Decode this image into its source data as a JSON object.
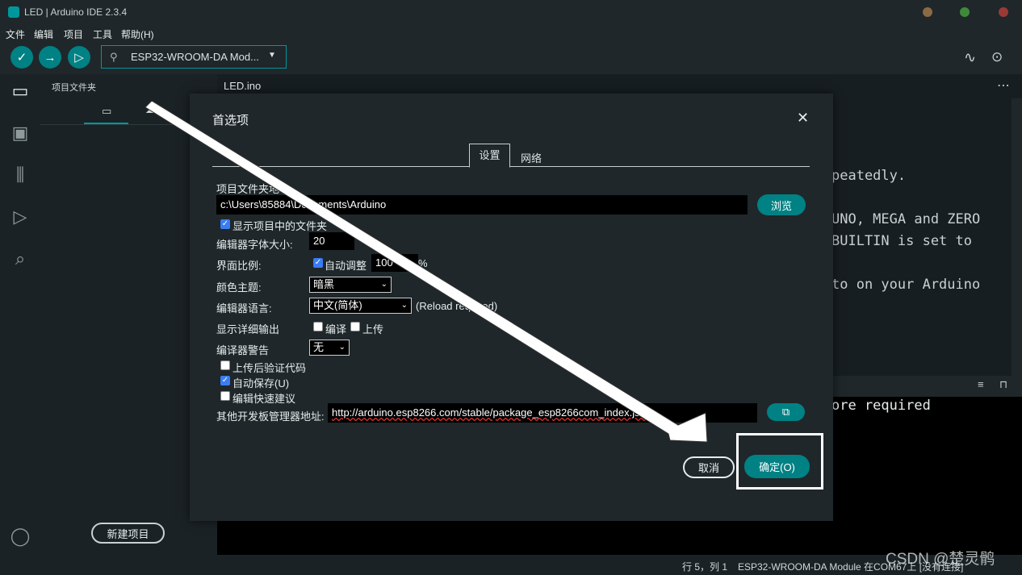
{
  "window": {
    "title": "LED | Arduino IDE 2.3.4"
  },
  "menu": [
    "文件",
    "编辑",
    "项目",
    "工具",
    "帮助(H)"
  ],
  "toolbar": {
    "board": "ESP32-WROOM-DA Mod..."
  },
  "sidebar": {
    "title": "项目文件夹",
    "new_project_label": "新建项目"
  },
  "editor": {
    "tab": "LED.ino",
    "code_fragments": [
      "peatedly.",
      "UNO, MEGA and ZERO",
      "BUILTIN is set to",
      "to on your Arduino"
    ]
  },
  "console": {
    "fragment": "ore required"
  },
  "statusbar": {
    "position": "行 5，列 1",
    "board_status": "ESP32-WROOM-DA Module 在COM67上 [没有连接]"
  },
  "watermark": "CSDN @楚灵鹘",
  "dialog": {
    "title": "首选项",
    "tabs": [
      "设置",
      "网络"
    ],
    "sketchbook_label": "项目文件夹地址:",
    "sketchbook_path": "c:\\Users\\85884\\Documents\\Arduino",
    "browse_label": "浏览",
    "show_files_label": "显示项目中的文件夹",
    "font_size_label": "编辑器字体大小:",
    "font_size_value": "20",
    "scale_label": "界面比例:",
    "auto_scale_label": "自动调整",
    "scale_value": "100",
    "scale_unit": "%",
    "theme_label": "颜色主题:",
    "theme_value": "暗黑",
    "language_label": "编辑器语言:",
    "language_value": "中文(简体)",
    "reload_note": "(Reload required)",
    "verbose_label": "显示详细输出",
    "verbose_compile_label": "编译",
    "verbose_upload_label": "上传",
    "warnings_label": "编译器警告",
    "warnings_value": "无",
    "verify_label": "上传后验证代码",
    "autosave_label": "自动保存(U)",
    "quick_suggest_label": "编辑快速建议",
    "board_urls_label": "其他开发板管理器地址:",
    "board_urls_value": "http://arduino.esp8266.com/stable/package_esp8266com_index.json",
    "cancel_label": "取消",
    "ok_label": "确定(O)"
  },
  "colors": {
    "accent": "#00979c",
    "background": "#171e21"
  }
}
